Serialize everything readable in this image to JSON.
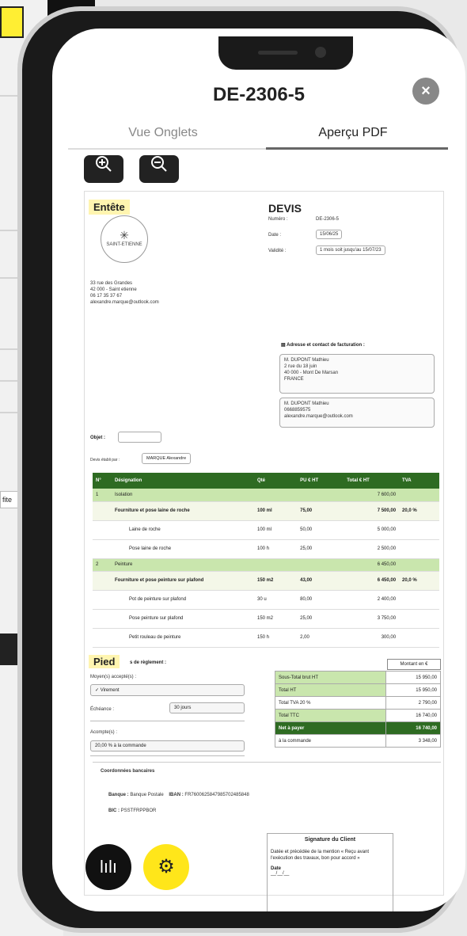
{
  "background": {
    "fragment_text": "fite"
  },
  "modal": {
    "title": "DE-2306-5",
    "close_label": "×",
    "tabs": [
      {
        "label": "Vue Onglets",
        "active": false
      },
      {
        "label": "Aperçu PDF",
        "active": true
      }
    ],
    "zoom_in_icon": "zoom-in-icon",
    "zoom_out_icon": "zoom-out-icon"
  },
  "document": {
    "entete_label": "Entête",
    "logo_text": "SAINT-ETIENNE",
    "address_lines": [
      "33 rue des Grandes",
      "42 000 - Saint etienne",
      "06 17 35 37 67",
      "alexandre.marque@outlook.com"
    ],
    "devis_title": "DEVIS",
    "numero_label": "Numéro :",
    "numero_value": "DE-2306-5",
    "date_label": "Date :",
    "date_value": "15/06/25",
    "validite_label": "Validité :",
    "validite_value": "1 mois soit jusqu'au 15/07/23",
    "billing_heading": "Adresse et contact de facturation :",
    "billing_address": [
      "M. DUPONT Mathieu",
      "2 rue du 18 juin",
      "40 000 - Mont De Marsan",
      "FRANCE"
    ],
    "billing_contact": [
      "M. DUPONT Mathieu",
      "0668859575",
      "alexandre.marque@outlook.com"
    ],
    "objet_label": "Objet :",
    "etabli_label": "Devis établi par :",
    "etabli_value": "MARQUE Alexandre",
    "table_headers": [
      "N°",
      "Désignation",
      "Qté",
      "PU € HT",
      "Total € HT",
      "TVA"
    ],
    "rows": [
      {
        "kind": "cat",
        "n": "1",
        "designation": "Isolation",
        "qte": "",
        "pu": "",
        "total": "7 600,00",
        "tva": ""
      },
      {
        "kind": "prod",
        "n": "",
        "designation": "Fourniture et pose laine de roche",
        "qte": "100 ml",
        "pu": "75,00",
        "total": "7 500,00",
        "tva": "20,0 %"
      },
      {
        "kind": "sub",
        "n": "",
        "designation": "Laine de roche",
        "qte": "100 ml",
        "pu": "50,00",
        "total": "5 000,00",
        "tva": ""
      },
      {
        "kind": "sub",
        "n": "",
        "designation": "Pose laine de roche",
        "qte": "100 h",
        "pu": "25,00",
        "total": "2 500,00",
        "tva": ""
      },
      {
        "kind": "cat",
        "n": "2",
        "designation": "Peinture",
        "qte": "",
        "pu": "",
        "total": "6 450,00",
        "tva": ""
      },
      {
        "kind": "prod",
        "n": "",
        "designation": "Fourniture et pose peinture sur plafond",
        "qte": "150 m2",
        "pu": "43,00",
        "total": "6 450,00",
        "tva": "20,0 %"
      },
      {
        "kind": "sub",
        "n": "",
        "designation": "Pot de peinture sur plafond",
        "qte": "30 u",
        "pu": "80,00",
        "total": "2 400,00",
        "tva": ""
      },
      {
        "kind": "sub",
        "n": "",
        "designation": "Pose peinture sur plafond",
        "qte": "150 m2",
        "pu": "25,00",
        "total": "3 750,00",
        "tva": ""
      },
      {
        "kind": "sub",
        "n": "",
        "designation": "Petit rouleau de peinture",
        "qte": "150 h",
        "pu": "2,00",
        "total": "300,00",
        "tva": ""
      }
    ],
    "pied_label": "Pied",
    "reglement_title": "s de règlement :",
    "moyens_label": "Moyen(s) accepté(s) :",
    "moyens_value": "Virement",
    "echeance_label": "Échéance :",
    "echeance_value": "30 jours",
    "acomptes_label": "Acompte(s) :",
    "acomptes_value": "20,00 % à la commande",
    "montant_header": "Montant en €",
    "totals": [
      {
        "label": "Sous-Total brut HT",
        "value": "15 950,00",
        "style": "g"
      },
      {
        "label": "Total HT",
        "value": "15 950,00",
        "style": "g"
      },
      {
        "label": "Total TVA 20 %",
        "value": "2 790,00",
        "style": ""
      },
      {
        "label": "Total TTC",
        "value": "16 740,00",
        "style": "g"
      },
      {
        "label": "Net à payer",
        "value": "16 740,00",
        "style": "dk"
      },
      {
        "label": "à la commande",
        "value": "3 348,00",
        "style": ""
      }
    ],
    "bank_title": "Coordonnées bancaires",
    "banque_label": "Banque :",
    "banque_value": "Banque Postale",
    "iban_label": "IBAN :",
    "iban_value": "FR7600625847985702485848",
    "bic_label": "BIC :",
    "bic_value": "PSSTFRPPBOR",
    "signature_title": "Signature du Client",
    "signature_text": "Datée et précédée de la mention « Reçu avant l'exécution des travaux, bon pour accord »",
    "signature_date_label": "Date",
    "signature_date_value": "__/__/__"
  },
  "fabs": {
    "chart_icon": "bar-chart-icon",
    "chart_glyph": "lılı",
    "gear_icon": "gear-icon",
    "gear_glyph": "⚙"
  },
  "colors": {
    "table_header": "#2e6b22",
    "category_row": "#c9e6ad",
    "highlight": "#fff5b0",
    "gear_fab": "#ffe61a"
  }
}
